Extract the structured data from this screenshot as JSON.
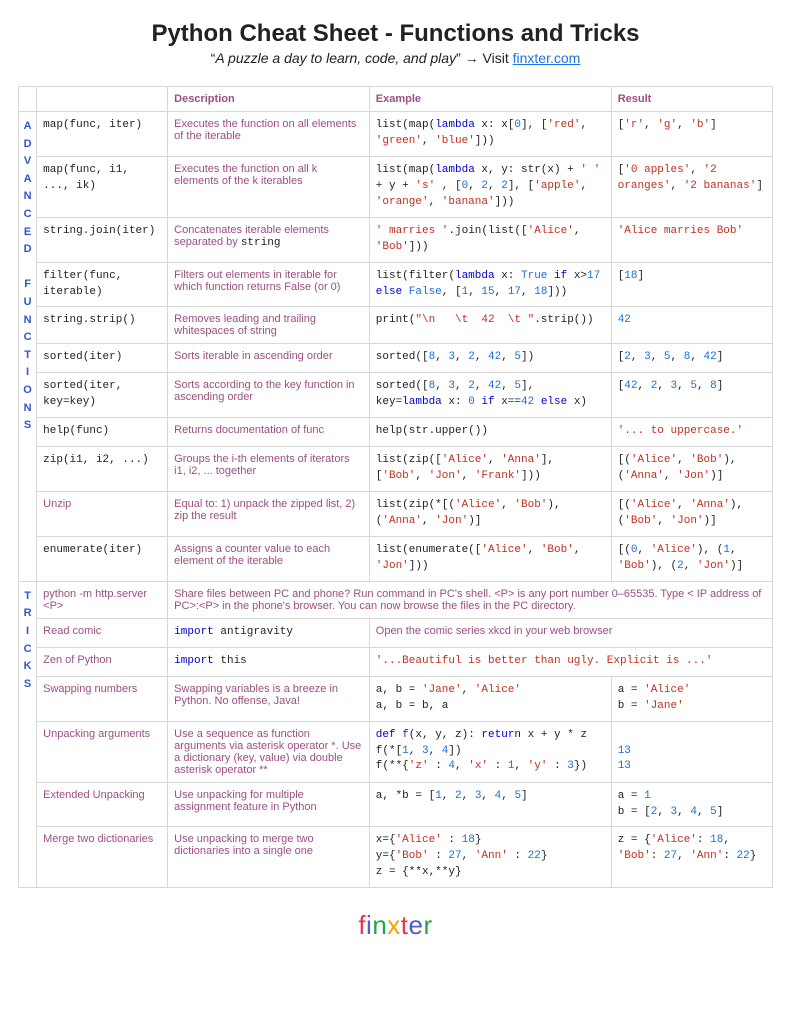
{
  "header": {
    "title": "Python Cheat Sheet - Functions and Tricks",
    "quote": "A puzzle a day to learn, code, and play",
    "visit_prefix": " → Visit ",
    "link": "finxter.com"
  },
  "columns": {
    "c1": "",
    "c2": "",
    "c3": "Description",
    "c4": "Example",
    "c5": "Result"
  },
  "section1_label": "A\nD\nV\nA\nN\nC\nE\nD\n\nF\nU\nN\nC\nT\nI\nO\nN\nS",
  "section2_label": "T\nR\nI\nC\nK\nS",
  "rows": [
    {
      "name_html": "map(func, iter)",
      "desc": "Executes the function on all elements of the iterable",
      "example_html": "list(map(<span class='kw'>lambda</span> x: x[<span class='num'>0</span>], [<span class='str'>'red'</span>, <span class='str'>'green'</span>, <span class='str'>'blue'</span>]))",
      "result_html": "[<span class='str'>'r'</span>, <span class='str'>'g'</span>, <span class='str'>'b'</span>]"
    },
    {
      "name_html": "map(func, i1, ..., ik)",
      "desc": "Executes the function on all k elements of the k iterables",
      "example_html": "list(map(<span class='kw'>lambda</span> x, y: str(x) + <span class='str'>' '</span> + y + <span class='str'>'s'</span> , [<span class='num'>0</span>, <span class='num'>2</span>, <span class='num'>2</span>], [<span class='str'>'apple'</span>, <span class='str'>'orange'</span>, <span class='str'>'banana'</span>]))",
      "result_html": "[<span class='str'>'0 apples'</span>, <span class='str'>'2 oranges'</span>, <span class='str'>'2 bananas'</span>]"
    },
    {
      "name_html": "string.join(iter)",
      "desc_html": "Concatenates iterable elements separated by <span class='mono' style='color:#222'>string</span>",
      "example_html": "<span class='str'>' marries '</span>.join(list([<span class='str'>'Alice'</span>, <span class='str'>'Bob'</span>]))",
      "result_html": "<span class='str'>'Alice marries Bob'</span>"
    },
    {
      "name_html": "filter(func, iterable)",
      "desc": "Filters out elements in iterable for which function returns False (or 0)",
      "example_html": "list(filter(<span class='kw'>lambda</span> x: <span class='bl'>True</span> <span class='kw'>if</span> x&gt;<span class='num'>17</span> <span class='kw'>else</span> <span class='bl'>False</span>, [<span class='num'>1</span>, <span class='num'>15</span>, <span class='num'>17</span>, <span class='num'>18</span>]))",
      "result_html": "[<span class='num'>18</span>]"
    },
    {
      "name_html": "string.strip()",
      "desc": "Removes leading and trailing whitespaces of string",
      "example_html": "print(<span class='str'>\"\\n   \\t  42  \\t \"</span>.strip())",
      "result_html": "<span class='num'>42</span>"
    },
    {
      "name_html": "sorted(iter)",
      "desc": "Sorts iterable in ascending order",
      "example_html": "sorted([<span class='num'>8</span>, <span class='num'>3</span>, <span class='num'>2</span>, <span class='num'>42</span>, <span class='num'>5</span>])",
      "result_html": "[<span class='num'>2</span>, <span class='num'>3</span>, <span class='num'>5</span>, <span class='num'>8</span>, <span class='num'>42</span>]"
    },
    {
      "name_html": "sorted(iter, key=key)",
      "desc": "Sorts according to the key function in ascending order",
      "example_html": "sorted([<span class='num'>8</span>, <span class='num'>3</span>, <span class='num'>2</span>, <span class='num'>42</span>, <span class='num'>5</span>], key=<span class='kw'>lambda</span> x: <span class='num'>0</span> <span class='kw'>if</span> x==<span class='num'>42</span> <span class='kw'>else</span> x)",
      "result_html": "[<span class='num'>42</span>, <span class='num'>2</span>, <span class='num'>3</span>, <span class='num'>5</span>, <span class='num'>8</span>]"
    },
    {
      "name_html": "help(func)",
      "desc": "Returns documentation of func",
      "example_html": "help(str.upper())",
      "result_html": "<span class='str'>'... to uppercase.'</span>"
    },
    {
      "name_html": "zip(i1, i2, ...)",
      "desc": "Groups the i-th elements of iterators i1, i2, ... together",
      "example_html": "list(zip([<span class='str'>'Alice'</span>, <span class='str'>'Anna'</span>], [<span class='str'>'Bob'</span>, <span class='str'>'Jon'</span>, <span class='str'>'Frank'</span>]))",
      "result_html": "[(<span class='str'>'Alice'</span>, <span class='str'>'Bob'</span>), (<span class='str'>'Anna'</span>, <span class='str'>'Jon'</span>)]"
    },
    {
      "name_plain": "Unzip",
      "name_pink": true,
      "desc": "Equal to: 1) unpack the zipped list, 2) zip the result",
      "example_html": "list(zip(*[(<span class='str'>'Alice'</span>, <span class='str'>'Bob'</span>), (<span class='str'>'Anna'</span>, <span class='str'>'Jon'</span>)]",
      "result_html": "[(<span class='str'>'Alice'</span>, <span class='str'>'Anna'</span>), (<span class='str'>'Bob'</span>, <span class='str'>'Jon'</span>)]"
    },
    {
      "name_html": "enumerate(iter)",
      "desc": "Assigns a counter value to each element of the iterable",
      "example_html": "list(enumerate([<span class='str'>'Alice'</span>, <span class='str'>'Bob'</span>, <span class='str'>'Jon'</span>]))",
      "result_html": "[(<span class='num'>0</span>, <span class='str'>'Alice'</span>), (<span class='num'>1</span>, <span class='str'>'Bob'</span>), (<span class='num'>2</span>, <span class='str'>'Jon'</span>)]"
    }
  ],
  "tricks": [
    {
      "name_plain": "python -m http.server <P>",
      "name_pink": true,
      "widecell_html": "Share files between PC and phone? Run command in PC's shell. &lt;P&gt; is any port number 0–65535. Type &lt; IP address of PC&gt;:&lt;P&gt; in the phone's browser. You can now browse the files in the PC directory.",
      "wide": 3
    },
    {
      "name_plain": "Read comic",
      "name_pink": true,
      "desc_code_html": "<span class='kw'>import</span> antigravity",
      "widecell_html": "Open the comic series xkcd in your web browser",
      "wide": 2
    },
    {
      "name_plain": "Zen of Python",
      "name_pink": true,
      "desc_code_html": "<span class='kw'>import</span> this",
      "widecell_html": "<span class='mono'><span class='str'>'...Beautiful is better than ugly. Explicit is ...'</span></span>",
      "wide": 2
    },
    {
      "name_plain": "Swapping numbers",
      "name_pink": true,
      "desc": "Swapping variables is a breeze in Python. No offense, Java!",
      "example_html": "a, b = <span class='str'>'Jane'</span>, <span class='str'>'Alice'</span>\na, b = b, a",
      "result_html": "a = <span class='str'>'Alice'</span>\nb = <span class='str'>'Jane'</span>"
    },
    {
      "name_plain": "Unpacking arguments",
      "name_pink": true,
      "desc": "Use a sequence as function arguments via asterisk operator *. Use a dictionary (key, value) via double asterisk operator **",
      "example_html": "<span class='kw'>def</span> <span class='fn'>f</span>(x, y, z): <span class='kw'>return</span> x + y * z\nf(*[<span class='num'>1</span>, <span class='num'>3</span>, <span class='num'>4</span>])\nf(**{<span class='str'>'z'</span> : <span class='num'>4</span>, <span class='str'>'x'</span> : <span class='num'>1</span>, <span class='str'>'y'</span> : <span class='num'>3</span>})",
      "result_html": "\n<span class='num'>13</span>\n<span class='num'>13</span>"
    },
    {
      "name_plain": "Extended Unpacking",
      "name_pink": true,
      "desc": "Use unpacking for multiple assignment feature in Python",
      "example_html": "a, *b = [<span class='num'>1</span>, <span class='num'>2</span>, <span class='num'>3</span>, <span class='num'>4</span>, <span class='num'>5</span>]",
      "result_html": "a = <span class='num'>1</span>\nb = [<span class='num'>2</span>, <span class='num'>3</span>, <span class='num'>4</span>, <span class='num'>5</span>]"
    },
    {
      "name_plain": "Merge two dictionaries",
      "name_pink": true,
      "desc": "Use unpacking to merge two dictionaries into a single one",
      "example_html": "x={<span class='str'>'Alice'</span> : <span class='num'>18</span>}\ny={<span class='str'>'Bob'</span> : <span class='num'>27</span>, <span class='str'>'Ann'</span> : <span class='num'>22</span>}\nz = {**x,**y}",
      "result_html": "z = {<span class='str'>'Alice'</span>: <span class='num'>18</span>, <span class='str'>'Bob'</span>: <span class='num'>27</span>, <span class='str'>'Ann'</span>: <span class='num'>22</span>}"
    }
  ],
  "footer_letters": [
    "f",
    "i",
    "n",
    "x",
    "t",
    "e",
    "r"
  ]
}
